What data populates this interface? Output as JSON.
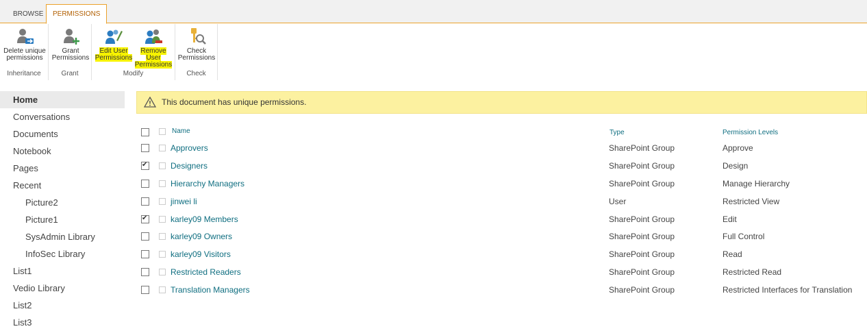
{
  "ribbon": {
    "tabs": [
      {
        "label": "BROWSE"
      },
      {
        "label": "PERMISSIONS"
      }
    ],
    "groups": {
      "inheritance": {
        "label": "Inheritance",
        "button_line1": "Delete unique",
        "button_line2": "permissions"
      },
      "grant": {
        "label": "Grant",
        "button_line1": "Grant",
        "button_line2": "Permissions"
      },
      "modify": {
        "label": "Modify",
        "edit_line1": "Edit User",
        "edit_line2": "Permissions",
        "remove_line1": "Remove User",
        "remove_line2": "Permissions"
      },
      "check": {
        "label": "Check",
        "button_line1": "Check",
        "button_line2": "Permissions"
      }
    },
    "highlight_color": "#f7f300",
    "accent_color": "#eba22c"
  },
  "nav": {
    "items": [
      {
        "label": "Home"
      },
      {
        "label": "Conversations"
      },
      {
        "label": "Documents"
      },
      {
        "label": "Notebook"
      },
      {
        "label": "Pages"
      },
      {
        "label": "Recent"
      },
      {
        "label": "Picture2"
      },
      {
        "label": "Picture1"
      },
      {
        "label": "SysAdmin Library"
      },
      {
        "label": "InfoSec Library"
      },
      {
        "label": "List1"
      },
      {
        "label": "Vedio Library"
      },
      {
        "label": "List2"
      },
      {
        "label": "List3"
      }
    ]
  },
  "warning": {
    "text": "This document has unique permissions.",
    "icon": "warning-triangle-icon"
  },
  "table": {
    "headers": {
      "name": "Name",
      "type": "Type",
      "permission": "Permission Levels"
    },
    "rows": [
      {
        "name": "Approvers",
        "type": "SharePoint Group",
        "permission": "Approve",
        "checked": false
      },
      {
        "name": "Designers",
        "type": "SharePoint Group",
        "permission": "Design",
        "checked": true
      },
      {
        "name": "Hierarchy Managers",
        "type": "SharePoint Group",
        "permission": "Manage Hierarchy",
        "checked": false
      },
      {
        "name": "jinwei li",
        "type": "User",
        "permission": "Restricted View",
        "checked": false
      },
      {
        "name": "karley09 Members",
        "type": "SharePoint Group",
        "permission": "Edit",
        "checked": true
      },
      {
        "name": "karley09 Owners",
        "type": "SharePoint Group",
        "permission": "Full Control",
        "checked": false
      },
      {
        "name": "karley09 Visitors",
        "type": "SharePoint Group",
        "permission": "Read",
        "checked": false
      },
      {
        "name": "Restricted Readers",
        "type": "SharePoint Group",
        "permission": "Restricted Read",
        "checked": false
      },
      {
        "name": "Translation Managers",
        "type": "SharePoint Group",
        "permission": "Restricted Interfaces for Translation",
        "checked": false
      }
    ]
  }
}
